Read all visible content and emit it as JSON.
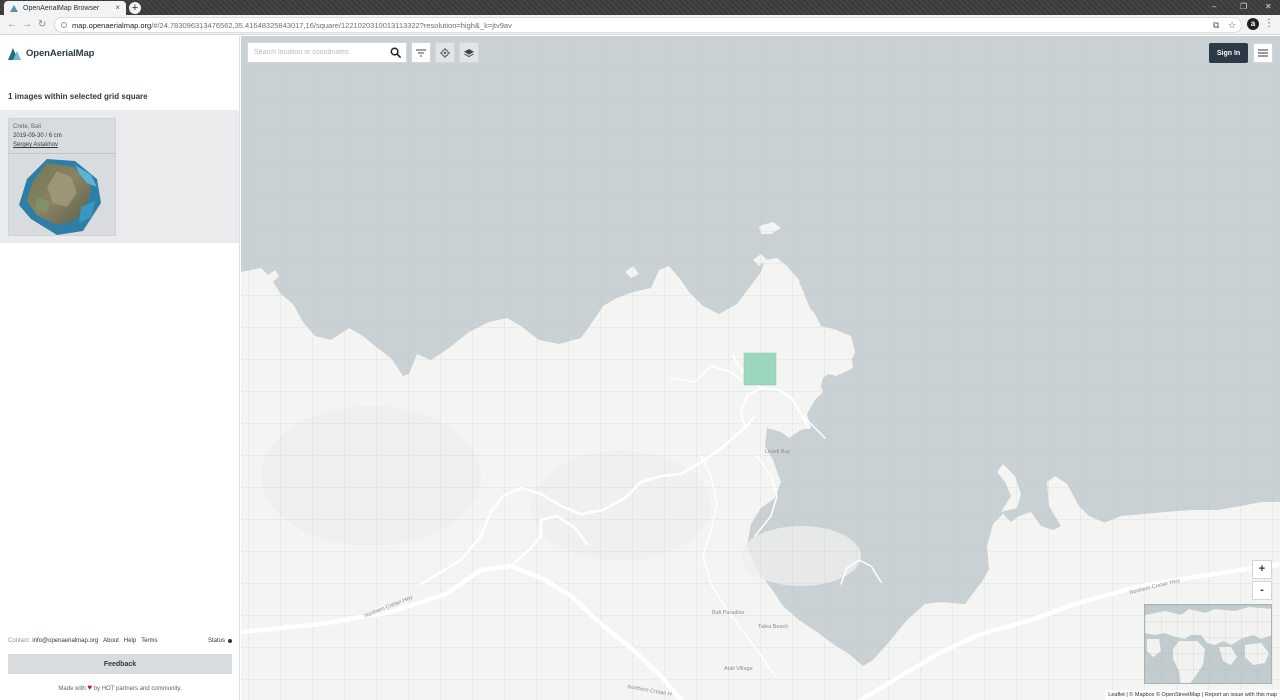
{
  "browser": {
    "tab_title": "OpenAerialMap Browser",
    "tab_close": "×",
    "new_tab": "+",
    "url_host": "map.openaerialmap.org",
    "url_rest": "/#/24.783096313476562,35.41648325843017,16/square/1221020310013113322?resolution=high&_k=jtv9av",
    "win_min": "–",
    "win_max": "❐",
    "win_close": "✕",
    "back": "←",
    "forward": "→",
    "reload": "↻",
    "translate_icon": "⧉",
    "star_icon": "☆",
    "ext_label": "a",
    "menu": "⋮"
  },
  "sidebar": {
    "brand": "OpenAerialMap",
    "results_title": "1 images within selected grid square",
    "results": [
      {
        "place": "Crete, Bali",
        "meta": "2019-09-30 / 6 cm",
        "author": "Sergey Astakhov"
      }
    ],
    "footer": {
      "contact_label": "Contact:",
      "contact_email": "info@openaerialmap.org",
      "links": [
        "About",
        "Help",
        "Terms"
      ],
      "status": "Status"
    },
    "feedback": "Feedback",
    "madewith_pre": "Made with",
    "madewith_post": "by HOT partners and community."
  },
  "map": {
    "search_placeholder": "Search location or coordinates",
    "sign_in": "Sign In",
    "zoom_in": "+",
    "zoom_out": "-",
    "labels": {
      "road_west": "Northern Cretan Hwy",
      "road_east": "Northern Cretan Hwy",
      "road_south": "Northern Cretan H",
      "bali_paradise": "Bali Paradise",
      "talea_beach": "Talea Beach",
      "atali_village": "Atali Village",
      "cove": "Livadi Bay"
    },
    "attribution": "Leaflet | © Mapbox © OpenStreetMap | Report an issue with this map",
    "colors": {
      "water": "#c9d1d4",
      "land": "#f4f4f3",
      "selected_square": "#9dd6bf",
      "accent": "#2b3a44"
    }
  }
}
